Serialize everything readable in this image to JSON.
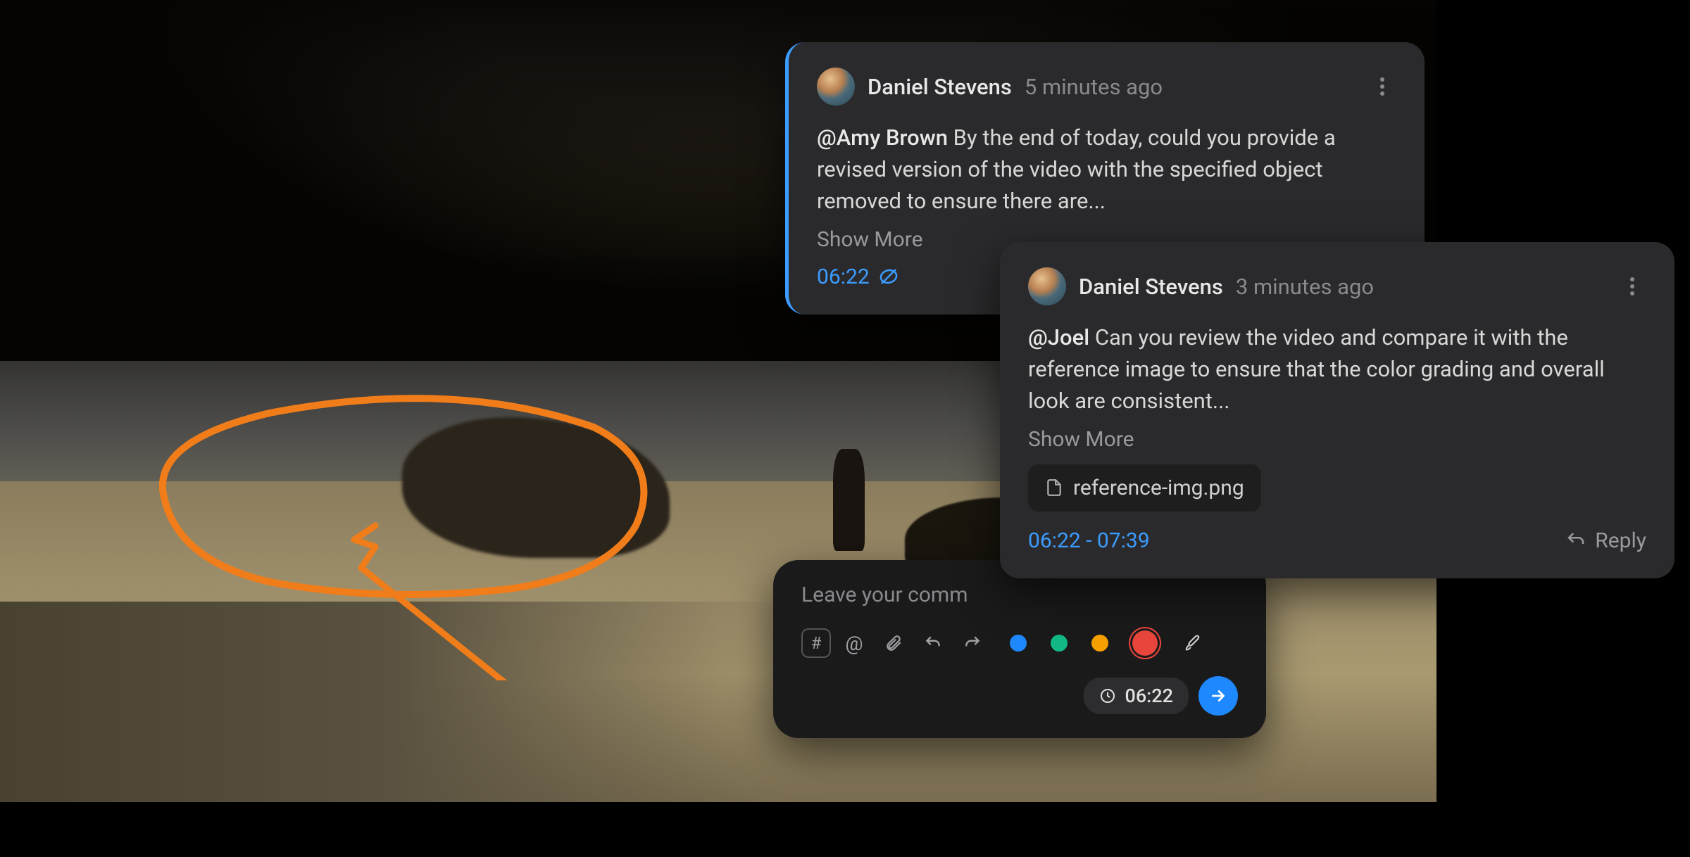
{
  "comments": [
    {
      "author": "Daniel Stevens",
      "relative_time": "5 minutes ago",
      "mention": "@Amy Brown",
      "body_after_mention": " By the end of today, could you provide a revised version of the video with the specified object removed to ensure there are...",
      "show_more": "Show More",
      "timecode": "06:22",
      "has_draw_icon": true
    },
    {
      "author": "Daniel Stevens",
      "relative_time": "3 minutes ago",
      "mention": "@Joel",
      "body_after_mention": " Can you review the video and compare it with the reference image to ensure that the color grading and overall look are consistent...",
      "show_more": "Show More",
      "attachment": "reference-img.png",
      "timecode": "06:22 - 07:39",
      "reply_label": "Reply"
    }
  ],
  "input": {
    "placeholder": "Leave your comm",
    "time_pill": "06:22",
    "colors": {
      "blue": "#1e88ff",
      "teal": "#12b886",
      "orange": "#f59f00",
      "red": "#e8463c"
    },
    "selected_color": "red"
  },
  "annotation": {
    "color": "#f07d1a"
  }
}
